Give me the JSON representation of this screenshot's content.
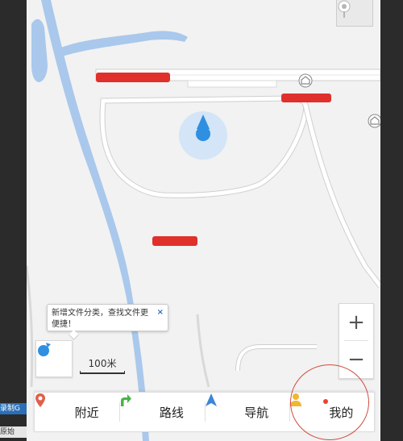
{
  "left_strip": {
    "top_label": "录制G",
    "bottom_label": "原始"
  },
  "tooltip": {
    "text": "新增文件分类，查找文件更便捷！",
    "close": "×"
  },
  "zoom": {
    "in_label": "+",
    "out_label": "−"
  },
  "scale": {
    "label": "100米"
  },
  "nav_tabs": [
    {
      "label": "附近",
      "icon": "pin-icon"
    },
    {
      "label": "路线",
      "icon": "route-arrow-icon"
    },
    {
      "label": "导航",
      "icon": "navigation-arrow-icon"
    },
    {
      "label": "我的",
      "icon": "person-icon"
    }
  ],
  "colors": {
    "road_fill": "#ffffff",
    "road_border": "#cfcfcf",
    "water": "#a9c8ec",
    "redaction": "#e0302b",
    "location_blue": "#2f8fe0",
    "accent_circle": "#d24a3d"
  }
}
